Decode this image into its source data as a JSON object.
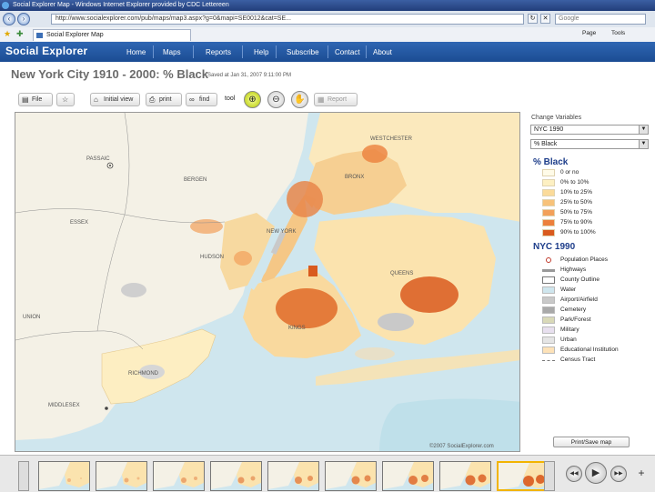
{
  "browser": {
    "window_title": "Social Explorer Map - Windows Internet Explorer provided by CDC Lettereen",
    "address": "http://www.socialexplorer.com/pub/maps/map3.aspx?g=0&mapi=SE0012&cat=SE...",
    "search_placeholder": "Google",
    "tab_title": "Social Explorer Map",
    "back_glyph": "‹",
    "forward_glyph": "›",
    "refresh_glyph": "↻",
    "stop_glyph": "✕",
    "menu_page": "Page",
    "menu_tools": "Tools"
  },
  "site": {
    "logo": "Social Explorer",
    "nav": [
      "Home",
      "Maps",
      "Reports",
      "Help",
      "Subscribe",
      "Contact",
      "About"
    ]
  },
  "page": {
    "title": "New York City 1910 - 2000: % Black",
    "saved": "Saved at Jan 31, 2007 9:11:00 PM"
  },
  "toolbar": {
    "file": "File",
    "initial_view": "Initial view",
    "print": "print",
    "find": "find",
    "tool": "tool",
    "report": "Report"
  },
  "panel": {
    "change_label": "Change Variables",
    "year_value": "NYC 1990",
    "variable_value": "% Black",
    "legend_title": "% Black",
    "classes": [
      {
        "label": "0 or no",
        "color": "#fffbe8"
      },
      {
        "label": "0% to 10%",
        "color": "#fdf0c2"
      },
      {
        "label": "10% to 25%",
        "color": "#fbdb9a"
      },
      {
        "label": "25% to 50%",
        "color": "#f7c27a"
      },
      {
        "label": "50% to 75%",
        "color": "#f2a05a"
      },
      {
        "label": "75% to 90%",
        "color": "#ec7f3c"
      },
      {
        "label": "90% to 100%",
        "color": "#d95a1e"
      }
    ],
    "layers_title": "NYC 1990",
    "layers": [
      {
        "label": "Population Places",
        "kind": "dot"
      },
      {
        "label": "Highways",
        "kind": "line",
        "color": "#999999"
      },
      {
        "label": "County Outline",
        "kind": "outline"
      },
      {
        "label": "Water",
        "kind": "box",
        "color": "#cfe6ee"
      },
      {
        "label": "Airport/Airfield",
        "kind": "box",
        "color": "#c9c9c9"
      },
      {
        "label": "Cemetery",
        "kind": "box",
        "color": "#a9a9a9"
      },
      {
        "label": "Park/Forest",
        "kind": "box",
        "color": "#d9d9b8"
      },
      {
        "label": "Military",
        "kind": "box",
        "color": "#e8e0ef"
      },
      {
        "label": "Urban",
        "kind": "box",
        "color": "#e5e5e5"
      },
      {
        "label": "Educational Institution",
        "kind": "box",
        "color": "#fde2b8"
      },
      {
        "label": "Census Tract",
        "kind": "dash"
      }
    ],
    "print_label": "Print/Save map"
  },
  "map": {
    "copyright": "©2007 SocialExplorer.com",
    "places": [
      {
        "name": "PASSAIC"
      },
      {
        "name": "BERGEN"
      },
      {
        "name": "ESSEX"
      },
      {
        "name": "WESTCHESTER"
      },
      {
        "name": "BRONX"
      },
      {
        "name": "NEW YORK"
      },
      {
        "name": "HUDSON"
      },
      {
        "name": "QUEENS"
      },
      {
        "name": "KINGS"
      },
      {
        "name": "UNION"
      },
      {
        "name": "RICHMOND"
      },
      {
        "name": "MIDDLESEX"
      }
    ]
  },
  "timeline": {
    "frames": 9,
    "active_index": 8,
    "rewind_glyph": "◀◀",
    "play_glyph": "▶",
    "forward_glyph": "▶▶",
    "zoom_glyph": "+"
  }
}
